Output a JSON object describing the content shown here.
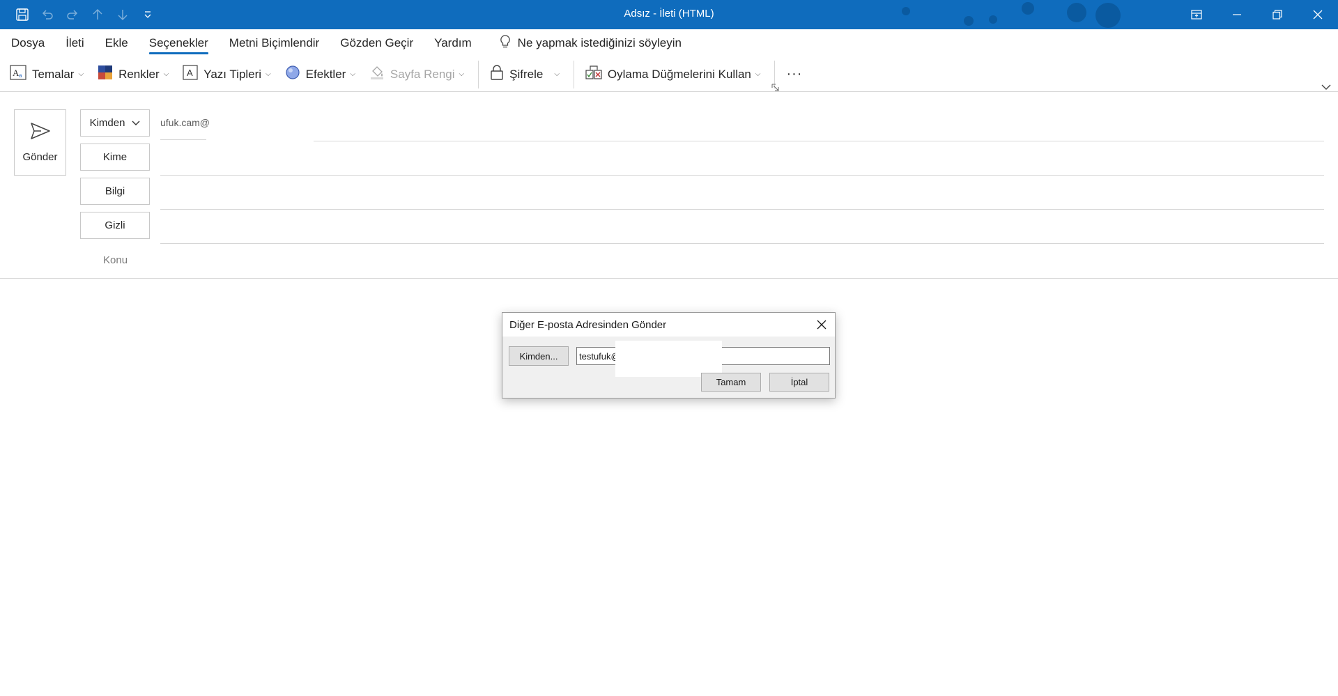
{
  "window": {
    "title": "Adsız  -  İleti (HTML)",
    "accent": "#0f6cbd"
  },
  "quick_access": {
    "items": [
      {
        "icon": "save-icon",
        "enabled": true
      },
      {
        "icon": "undo-icon",
        "enabled": false
      },
      {
        "icon": "redo-icon",
        "enabled": false
      },
      {
        "icon": "arrow-up-icon",
        "enabled": false
      },
      {
        "icon": "arrow-down-icon",
        "enabled": false
      },
      {
        "icon": "customize-qat-icon",
        "enabled": true
      }
    ]
  },
  "window_controls": [
    "ribbon-display-icon",
    "minimize-icon",
    "restore-icon",
    "close-icon"
  ],
  "tabs": {
    "items": [
      {
        "label": "Dosya"
      },
      {
        "label": "İleti"
      },
      {
        "label": "Ekle"
      },
      {
        "label": "Seçenekler",
        "active": true
      },
      {
        "label": "Metni Biçimlendir"
      },
      {
        "label": "Gözden Geçir"
      },
      {
        "label": "Yardım"
      }
    ],
    "tell_me": "Ne yapmak istediğinizi söyleyin"
  },
  "ribbon": {
    "themes": "Temalar",
    "colors": "Renkler",
    "fonts": "Yazı Tipleri",
    "effects": "Efektler",
    "page_color": "Sayfa Rengi",
    "encrypt": "Şifrele",
    "voting": "Oylama Düğmelerini Kullan",
    "more": "···"
  },
  "compose": {
    "send_label": "Gönder",
    "from_label": "Kimden",
    "from_value": "ufuk.cam@",
    "to_label": "Kime",
    "cc_label": "Bilgi",
    "bcc_label": "Gizli",
    "subject_label": "Konu"
  },
  "dialog": {
    "title": "Diğer E-posta Adresinden Gönder",
    "from_button": "Kimden...",
    "from_value": "testufuk@",
    "ok_label": "Tamam",
    "cancel_label": "İptal"
  }
}
